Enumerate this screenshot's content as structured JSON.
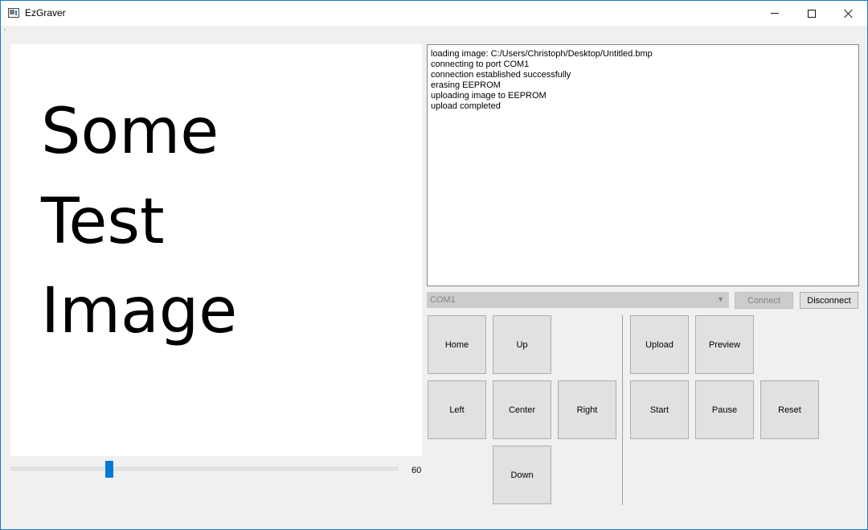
{
  "window": {
    "title": "EzGraver"
  },
  "image_preview": {
    "lines": [
      "Some",
      "Test",
      "Image"
    ]
  },
  "burn_time": {
    "value": "60",
    "fraction": 0.25
  },
  "log": {
    "lines": [
      "loading image: C:/Users/Christoph/Desktop/Untitled.bmp",
      "connecting to port COM1",
      "connection established successfully",
      "erasing EEPROM",
      "uploading image to EEPROM",
      "upload completed"
    ]
  },
  "port": {
    "selected": "COM1",
    "connect_label": "Connect",
    "disconnect_label": "Disconnect"
  },
  "movement": {
    "home": "Home",
    "up": "Up",
    "left": "Left",
    "center": "Center",
    "right": "Right",
    "down": "Down"
  },
  "engraving": {
    "upload": "Upload",
    "preview": "Preview",
    "start": "Start",
    "pause": "Pause",
    "reset": "Reset"
  },
  "colors": {
    "accent": "#0078d7",
    "window_border": "#1979ca",
    "background": "#f0f0f0"
  }
}
